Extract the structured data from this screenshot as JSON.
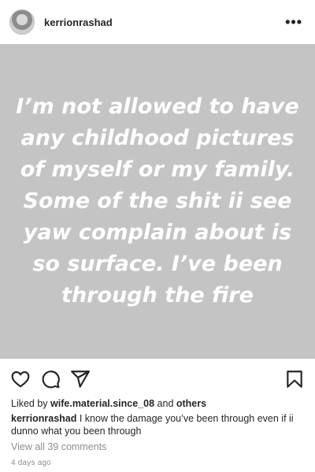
{
  "header": {
    "username": "kerrionrashad",
    "more_label": "•••"
  },
  "post": {
    "text": "I’m not allowed to have any childhood pictures of myself or my family. Some of the shit ii see yaw complain about is so surface. I’ve been through the fire",
    "background_color": "#c4c4c4"
  },
  "actions": {
    "icons": [
      "heart-icon",
      "comment-icon",
      "share-icon",
      "bookmark-icon"
    ]
  },
  "likes": {
    "prefix": "Liked by ",
    "user": "wife.material.since_08",
    "conjunction": " and ",
    "others": "others"
  },
  "caption": {
    "username": "kerrionrashad",
    "text": "I know the damage you’ve been through even if ii dunno what you been through"
  },
  "comments": {
    "view_all_label": "View all 39 comments"
  },
  "timestamp": "4 days ago"
}
